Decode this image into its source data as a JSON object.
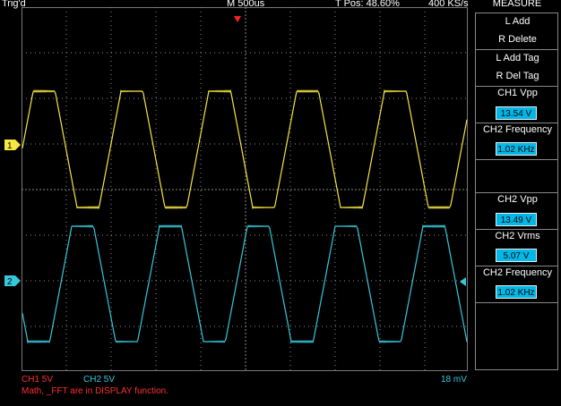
{
  "header": {
    "trig_status": "Trig'd",
    "timebase": "M 500us",
    "trigger_pos": "T Pos: 48.60%",
    "sample_rate": "400 KS/s"
  },
  "menu": {
    "title": "MEASURE",
    "items": [
      {
        "lines": [
          "L Add",
          "R Delete"
        ]
      },
      {
        "lines": [
          "L Add Tag",
          "R Del Tag"
        ]
      },
      {
        "label": "CH1 Vpp",
        "value": "13.54 V"
      },
      {
        "label": "CH2 Frequency",
        "value": "1.02 KHz"
      },
      {
        "label": "CH2 Vpp",
        "value": "13.49 V"
      },
      {
        "label": "CH2 Vrms",
        "value": "5.07 V"
      },
      {
        "label": "CH2 Frequency",
        "value": "1.02 KHz"
      }
    ]
  },
  "channels": {
    "ch1": {
      "marker": "1",
      "color": "#f5e642",
      "scale": "CH1  5V"
    },
    "ch2": {
      "marker": "2",
      "color": "#37c8dc",
      "scale": "CH2  5V"
    }
  },
  "footer": {
    "math_note": "Math, _FFT are in DISPLAY function.",
    "trigger_level": "18 mV"
  },
  "colors": {
    "warning_red": "#ff3030",
    "grid": "#8a8a8a",
    "value_bg": "#00b8e8",
    "trigger_marker": "#ff2020"
  }
}
